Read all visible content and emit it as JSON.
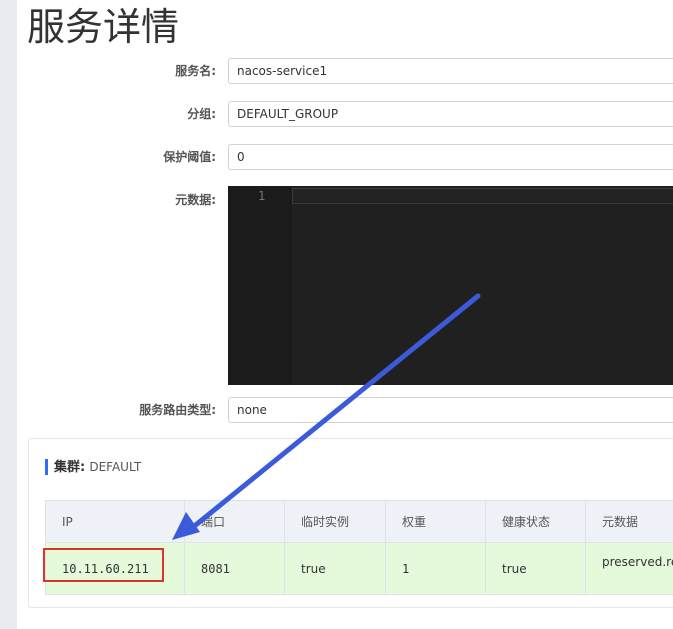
{
  "page": {
    "title": "服务详情"
  },
  "form": {
    "service_name": {
      "label": "服务名:",
      "value": "nacos-service1"
    },
    "group": {
      "label": "分组:",
      "value": "DEFAULT_GROUP"
    },
    "protect_threshold": {
      "label": "保护阈值:",
      "value": "0"
    },
    "metadata": {
      "label": "元数据:",
      "editor_line_number": "1"
    },
    "selector_type": {
      "label": "服务路由类型:",
      "value": "none"
    }
  },
  "cluster": {
    "heading_label": "集群:",
    "name": "DEFAULT",
    "columns": [
      "IP",
      "端口",
      "临时实例",
      "权重",
      "健康状态",
      "元数据"
    ],
    "rows": [
      {
        "ip": "10.11.60.211",
        "port": "8081",
        "ephemeral": "true",
        "weight": "1",
        "healthy": "true",
        "metadata": "preserved.re"
      }
    ]
  },
  "annotation": {
    "highlight_color": "#e0322d",
    "arrow_color": "#3b5bdb"
  }
}
